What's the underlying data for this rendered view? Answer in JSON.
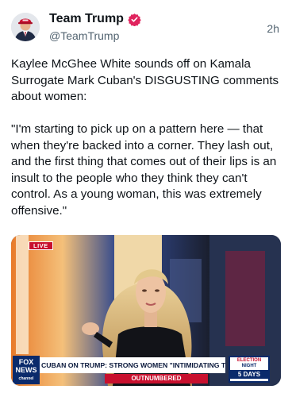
{
  "tweet": {
    "display_name": "Team Trump",
    "handle": "@TeamTrump",
    "time": "2h",
    "verified_icon": "verified-badge-icon",
    "verified_color": "#e0245e",
    "text": "Kaylee McGhee White sounds off on Kamala Surrogate Mark Cuban's DISGUSTING comments about women:\n\n\"I'm starting to pick up on a pattern here — that when they're backed into a corner. They lash out, and the first thing that comes out of their lips is an insult to the people who they think they can't control. As a young woman, this was extremely offensive.\""
  },
  "media": {
    "live_badge": "LIVE",
    "network_logo": "FOX NEWS",
    "network_logo_sub": "channel",
    "chyron": "CUBAN ON TRUMP: STRONG WOMEN \"INTIMIDATING TO HIM\"",
    "show_name": "OUTNUMBERED",
    "election_line1": "ELECTION",
    "election_line2": "NIGHT",
    "election_days": "5 DAYS"
  },
  "colors": {
    "text_primary": "#0f1419",
    "text_secondary": "#536471",
    "fox_red": "#c8102e",
    "fox_blue": "#0a2a6b"
  }
}
